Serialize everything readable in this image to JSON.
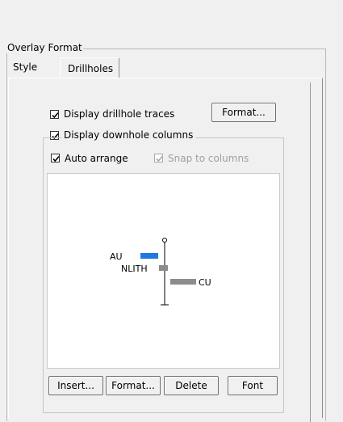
{
  "overlay_format": {
    "legend": "Overlay Format"
  },
  "tabs": [
    {
      "label": "Style",
      "selected": false
    },
    {
      "label": "Drillholes",
      "selected": true
    }
  ],
  "drillholes": {
    "display_traces": {
      "label": "Display drillhole traces",
      "checked": true
    },
    "traces_format_button": "Format...",
    "display_columns": {
      "label": "Display downhole columns",
      "checked": true
    },
    "auto_arrange": {
      "label": "Auto arrange",
      "checked": true
    },
    "snap_to_columns": {
      "label": "Snap to columns",
      "checked": true,
      "enabled": false
    }
  },
  "preview": {
    "columns": [
      {
        "label": "AU",
        "color": "#1e78e0"
      },
      {
        "label": "NLITH",
        "color": "#8c8c8c"
      },
      {
        "label": "CU",
        "color": "#8c8c8c"
      }
    ]
  },
  "buttons": {
    "insert": "Insert...",
    "format": "Format...",
    "delete": "Delete",
    "font": "Font"
  }
}
